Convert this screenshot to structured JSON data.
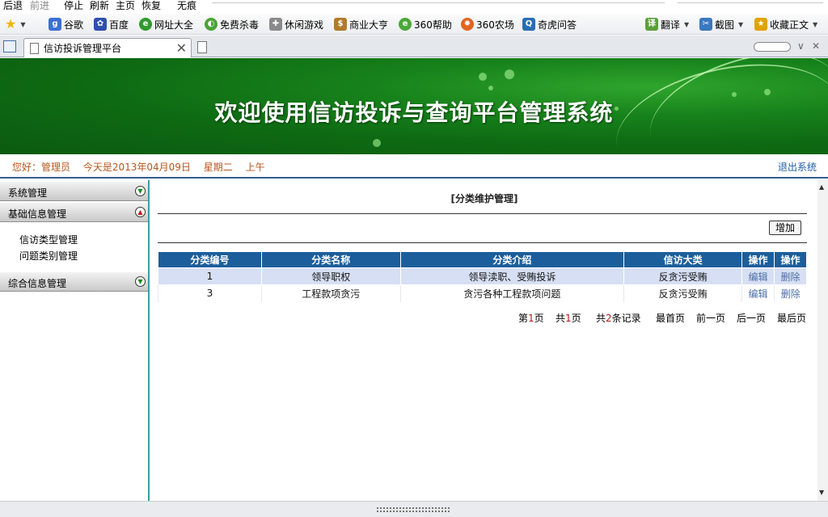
{
  "browser": {
    "menu": {
      "back": "后退",
      "forward": "前进",
      "stop": "停止",
      "refresh": "刷新",
      "home": "主页",
      "restore": "恢复",
      "incognito": "无痕"
    },
    "favorites": [
      {
        "label": "谷歌",
        "icon": "google-icon",
        "color": "#3b6fd6"
      },
      {
        "label": "百度",
        "icon": "baidu-paw-icon",
        "color": "#2f4fb0"
      },
      {
        "label": "网址大全",
        "icon": "site-guide-icon",
        "color": "#2f9a2f"
      },
      {
        "label": "免费杀毒",
        "icon": "antivirus-icon",
        "color": "#4aa336"
      },
      {
        "label": "休闲游戏",
        "icon": "gamepad-icon",
        "color": "#666666"
      },
      {
        "label": "商业大亨",
        "icon": "business-tycoon-icon",
        "color": "#b27a2a"
      },
      {
        "label": "360帮助",
        "icon": "help-360-icon",
        "color": "#49a83a"
      },
      {
        "label": "360农场",
        "icon": "farm-360-icon",
        "color": "#e0661f"
      },
      {
        "label": "奇虎问答",
        "icon": "qihoo-qa-icon",
        "color": "#2a6fb0"
      }
    ],
    "tools": {
      "translate": "翻译",
      "screenshot": "截图",
      "favorite": "收藏正文"
    },
    "tab_title": "信访投诉管理平台"
  },
  "banner": {
    "title": "欢迎使用信访投诉与查询平台管理系统"
  },
  "infobar": {
    "greeting": "您好：管理员",
    "date": "今天是2013年04月09日",
    "weekday": "星期二",
    "period": "上午",
    "logout": "退出系统"
  },
  "sidebar": {
    "groups": [
      {
        "label": "系统管理",
        "state": "collapsed"
      },
      {
        "label": "基础信息管理",
        "state": "expanded"
      },
      {
        "label": "综合信息管理",
        "state": "collapsed"
      }
    ],
    "subitems": [
      "信访类型管理",
      "问题类别管理"
    ]
  },
  "main": {
    "title": "[分类维护管理]",
    "add_button": "增加",
    "columns": [
      "分类编号",
      "分类名称",
      "分类介绍",
      "信访大类",
      "操作",
      "操作"
    ],
    "rows": [
      {
        "id": "1",
        "name": "领导职权",
        "desc": "领导渎职、受贿投诉",
        "category": "反贪污受贿",
        "edit": "编辑",
        "delete": "删除"
      },
      {
        "id": "3",
        "name": "工程款项贪污",
        "desc": "贪污各种工程款项问题",
        "category": "反贪污受贿",
        "edit": "编辑",
        "delete": "删除"
      }
    ],
    "pager": {
      "page_prefix": "第",
      "page_num": "1",
      "page_suffix": "页",
      "total_prefix": "共",
      "total_pages": "1",
      "total_suffix": "页",
      "records_prefix": "共",
      "records": "2",
      "records_suffix": "条记录",
      "first": "最首页",
      "prev": "前一页",
      "next": "后一页",
      "last": "最后页"
    }
  },
  "colors": {
    "banner_green": "#117318",
    "header_blue": "#1c5e9b",
    "row_highlight": "#d6dff3",
    "accent_orange": "#b5561c",
    "link_blue": "#4d6fa7",
    "number_red": "#c01717"
  }
}
